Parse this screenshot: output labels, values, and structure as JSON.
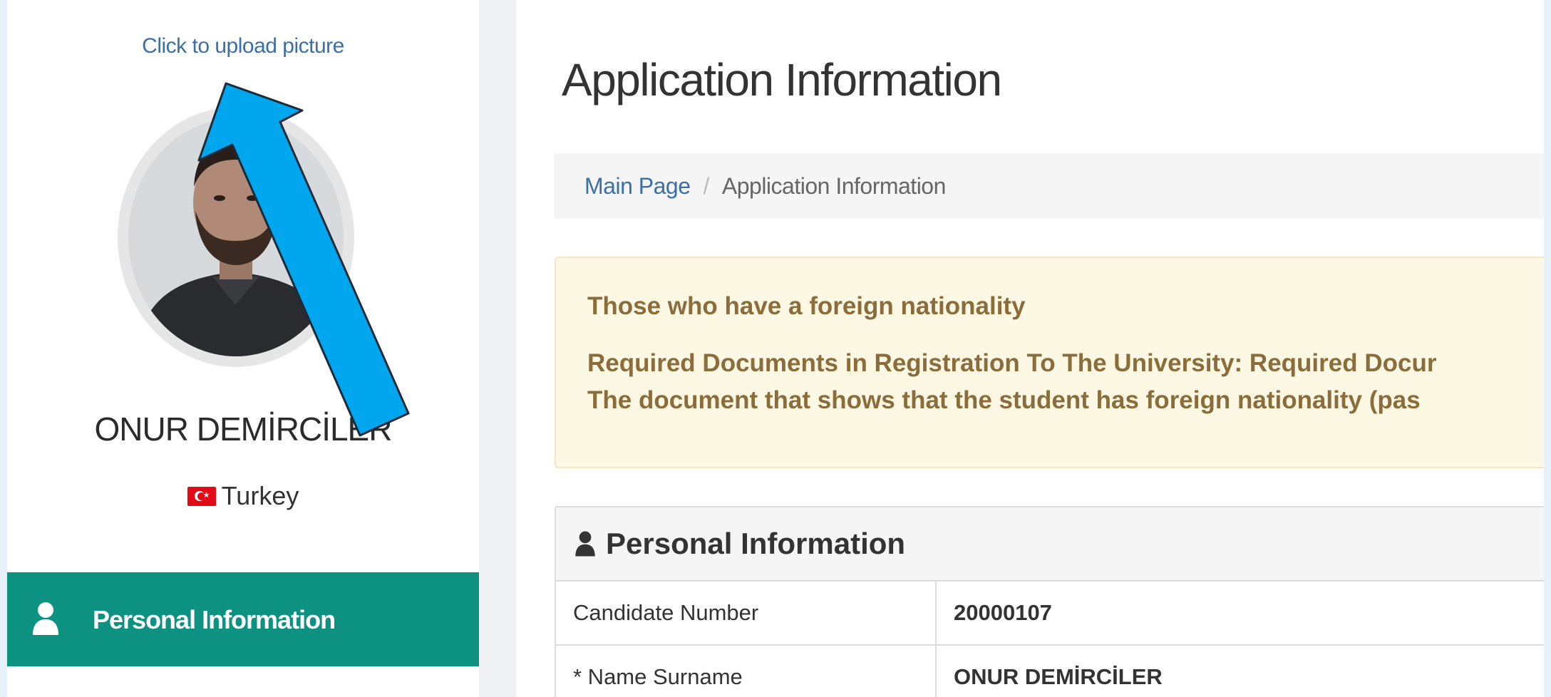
{
  "sidebar": {
    "upload_link": "Click to upload picture",
    "profile_name": "ONUR DEMİRCİLER",
    "country": "Turkey",
    "menu": [
      {
        "label": "Personal Information",
        "icon": "user-icon",
        "active": true
      }
    ]
  },
  "main": {
    "title": "Application Information",
    "breadcrumb": {
      "home": "Main Page",
      "separator": "/",
      "current": "Application Information"
    },
    "alert": {
      "title": "Those who have a foreign nationality",
      "line1": "Required Documents in Registration To The University: Required Docur",
      "line2": "The document that shows that the student has foreign nationality (pas"
    },
    "panel": {
      "title": "Personal Information",
      "rows": [
        {
          "label": "Candidate Number",
          "value": "20000107"
        },
        {
          "label": "* Name Surname",
          "value": "ONUR DEMİRCİLER"
        }
      ]
    }
  },
  "colors": {
    "accent": "#0d9181",
    "link": "#3a6fa8",
    "alert_bg": "#fcf8e3",
    "alert_text": "#8a6d3b",
    "annotation_arrow": "#00a6ee"
  }
}
